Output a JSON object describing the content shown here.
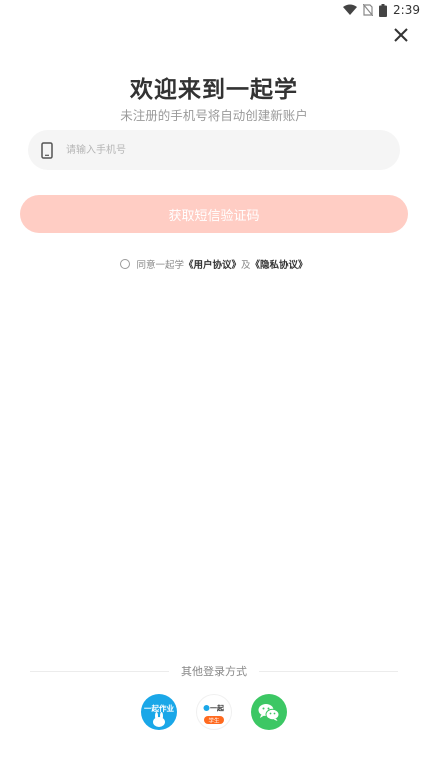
{
  "status_bar": {
    "time": "2:39"
  },
  "login": {
    "title": "欢迎来到一起学",
    "subtitle": "未注册的手机号将自动创建新账户",
    "phone_placeholder": "请输入手机号",
    "phone_value": "",
    "sms_button_label": "获取短信验证码",
    "agree_prefix": "同意一起学",
    "user_agreement": "《用户协议》",
    "and": "及",
    "privacy_agreement": "《隐私协议》"
  },
  "other_login": {
    "label": "其他登录方式",
    "options": [
      {
        "name": "yiqizuoye",
        "text": "一起作业",
        "color": "#1aa7e8"
      },
      {
        "name": "yiqixue",
        "text": "一起",
        "subtext": "学生",
        "color": "#ff6a1f"
      },
      {
        "name": "wechat",
        "color": "#3cc764"
      }
    ]
  },
  "colors": {
    "accent_disabled": "#ffcdc4",
    "field_bg": "#f5f5f5"
  }
}
